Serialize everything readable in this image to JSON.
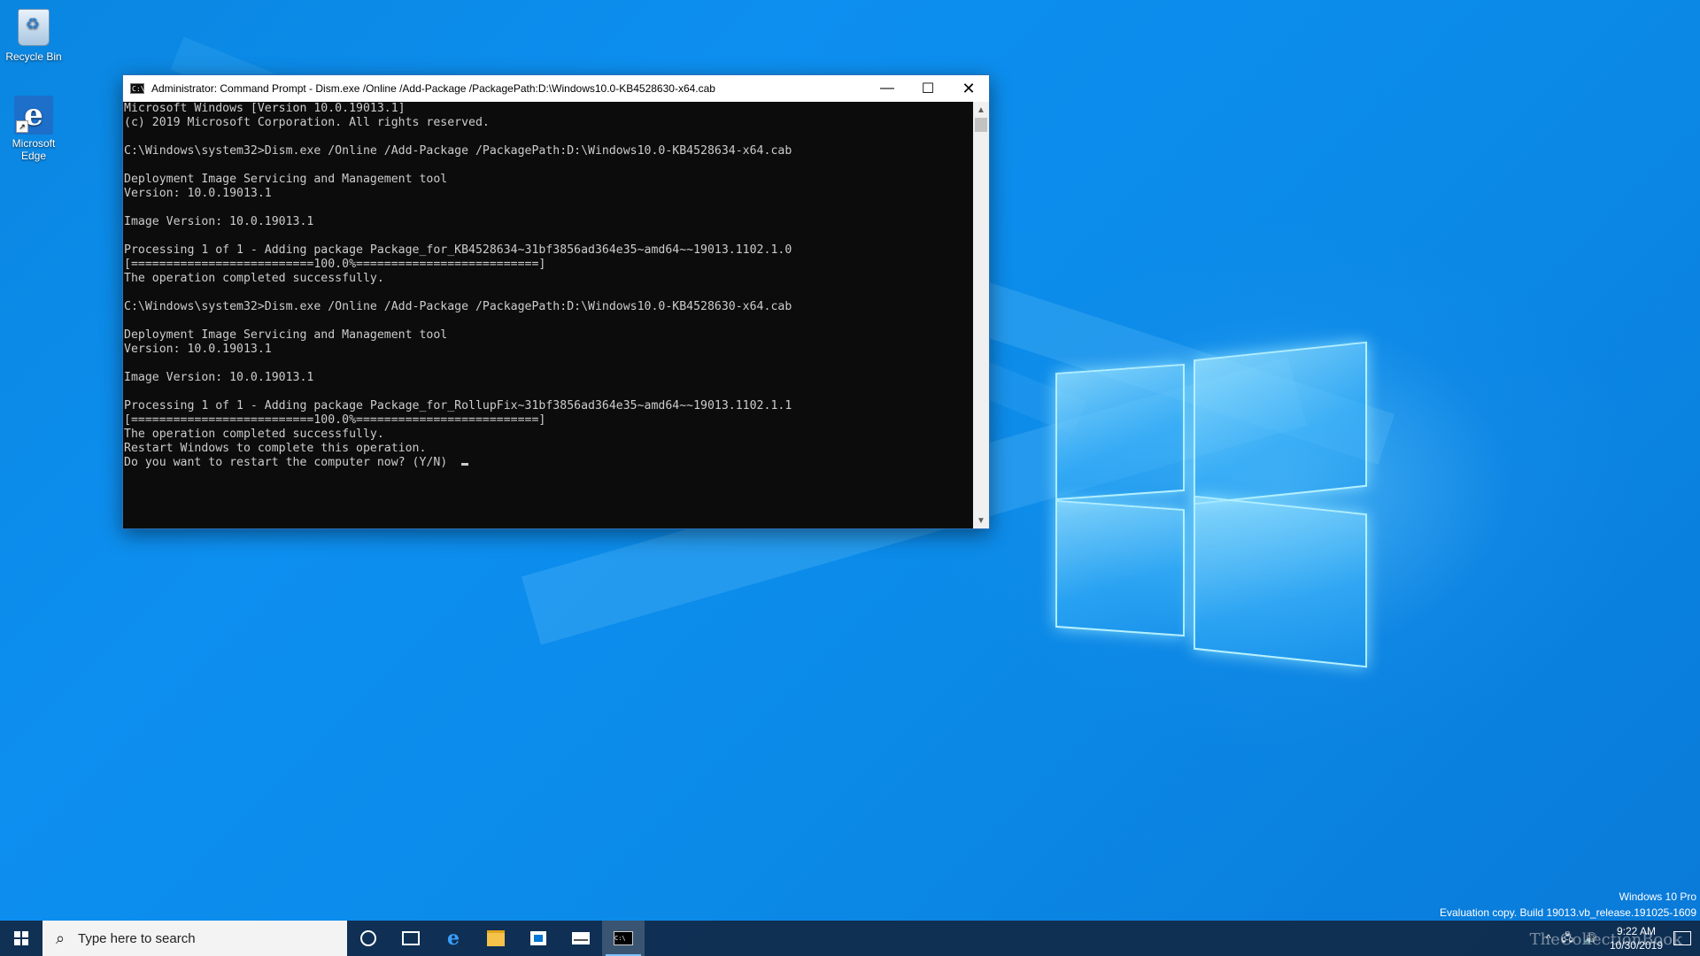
{
  "desktop": {
    "icons": [
      {
        "label": "Recycle Bin",
        "icon": "recycle-bin-icon"
      },
      {
        "label": "Microsoft Edge",
        "icon": "edge-icon"
      }
    ]
  },
  "window": {
    "title": "Administrator: Command Prompt - Dism.exe  /Online /Add-Package /PackagePath:D:\\Windows10.0-KB4528630-x64.cab",
    "controls": {
      "minimize": "—",
      "maximize": "☐",
      "close": "✕"
    }
  },
  "console": {
    "lines": [
      "Microsoft Windows [Version 10.0.19013.1]",
      "(c) 2019 Microsoft Corporation. All rights reserved.",
      "",
      "C:\\Windows\\system32>Dism.exe /Online /Add-Package /PackagePath:D:\\Windows10.0-KB4528634-x64.cab",
      "",
      "Deployment Image Servicing and Management tool",
      "Version: 10.0.19013.1",
      "",
      "Image Version: 10.0.19013.1",
      "",
      "Processing 1 of 1 - Adding package Package_for_KB4528634~31bf3856ad364e35~amd64~~19013.1102.1.0",
      "[==========================100.0%==========================]",
      "The operation completed successfully.",
      "",
      "C:\\Windows\\system32>Dism.exe /Online /Add-Package /PackagePath:D:\\Windows10.0-KB4528630-x64.cab",
      "",
      "Deployment Image Servicing and Management tool",
      "Version: 10.0.19013.1",
      "",
      "Image Version: 10.0.19013.1",
      "",
      "Processing 1 of 1 - Adding package Package_for_RollupFix~31bf3856ad364e35~amd64~~19013.1102.1.1",
      "[==========================100.0%==========================]",
      "The operation completed successfully.",
      "Restart Windows to complete this operation.",
      "Do you want to restart the computer now? (Y/N) "
    ]
  },
  "watermark": {
    "edition": "Windows 10 Pro",
    "build": "Evaluation copy. Build 19013.vb_release.191025-1609",
    "brand": "TheCollectionBook"
  },
  "taskbar": {
    "search_placeholder": "Type here to search",
    "time": "9:22 AM",
    "date": "10/30/2019",
    "tray_glyphs": {
      "chevron": "^",
      "network": "🖧",
      "volume": "🔊"
    }
  }
}
